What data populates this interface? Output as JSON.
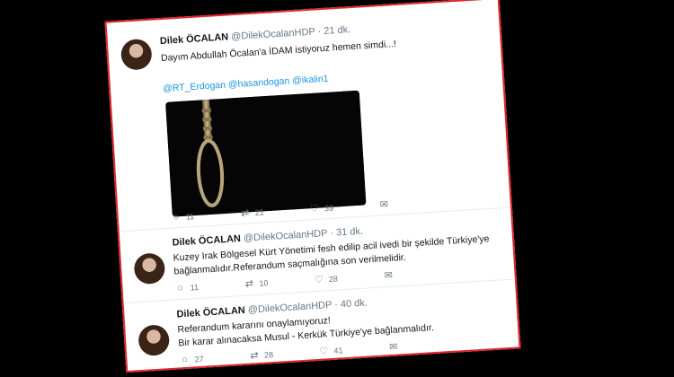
{
  "tweets": [
    {
      "name": "Dilek ÖCALAN",
      "handle": "@DilekOcalanHDP",
      "time": "· 21 dk.",
      "line1": "Dayım Abdullah Öcalan'a İDAM istiyoruz hemen simdi...!",
      "mentions": "@RT_Erdogan @hasandogan @ikalin1",
      "actions": {
        "reply": "11",
        "retweet": "21",
        "like": "39"
      }
    },
    {
      "name": "Dilek ÖCALAN",
      "handle": "@DilekOcalanHDP",
      "time": "· 31 dk.",
      "line1": "Kuzey Irak Bölgesel Kürt Yönetimi fesh edilip acil ivedi bir şekilde Türkiye'ye",
      "line2": "bağlanmalıdır.Referandum saçmalığına son verilmelidir.",
      "actions": {
        "reply": "11",
        "retweet": "10",
        "like": "28"
      }
    },
    {
      "name": "Dilek ÖCALAN",
      "handle": "@DilekOcalanHDP",
      "time": "· 40 dk.",
      "line1": "Referandum kararını onaylamıyoruz!",
      "line2": "Bir karar alınacaksa Musul - Kerkük Türkiye'ye bağlanmalıdır.",
      "actions": {
        "reply": "27",
        "retweet": "28",
        "like": "41"
      }
    }
  ]
}
